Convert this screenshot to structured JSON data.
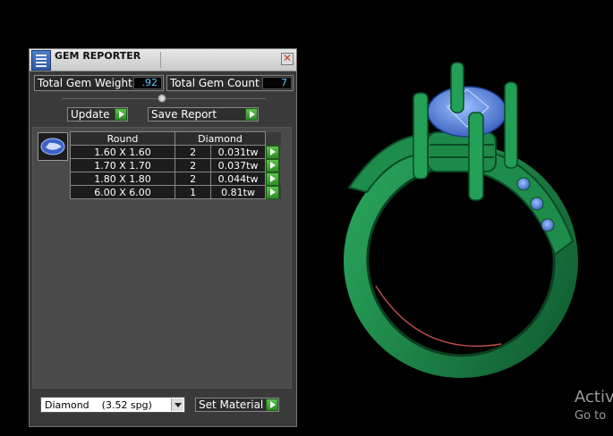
{
  "window": {
    "title": "GEM REPORTER",
    "close_label": "✕"
  },
  "stats": {
    "total_weight_label": "Total Gem Weight",
    "total_weight_value": ".92",
    "total_count_label": "Total Gem Count",
    "total_count_value": "7"
  },
  "toolbar": {
    "update_label": "Update",
    "save_report_label": "Save Report"
  },
  "table": {
    "columns": [
      "Round",
      "Diamond"
    ],
    "rows": [
      {
        "size": "1.60 X 1.60",
        "count": "2",
        "weight": "0.031tw"
      },
      {
        "size": "1.70 X 1.70",
        "count": "2",
        "weight": "0.037tw"
      },
      {
        "size": "1.80 X 1.80",
        "count": "2",
        "weight": "0.044tw"
      },
      {
        "size": "6.00 X 6.00",
        "count": "1",
        "weight": "0.81tw"
      }
    ]
  },
  "material": {
    "selected": "Diamond    (3.52 spg)",
    "set_label": "Set Material"
  },
  "watermark": {
    "line1": "Activ",
    "line2": "Go to"
  },
  "colors": {
    "ring": "#1f8a4c",
    "gem": "#4a7fe0",
    "accent_value": "#5cc8ff",
    "play_button": "#3fa633"
  }
}
